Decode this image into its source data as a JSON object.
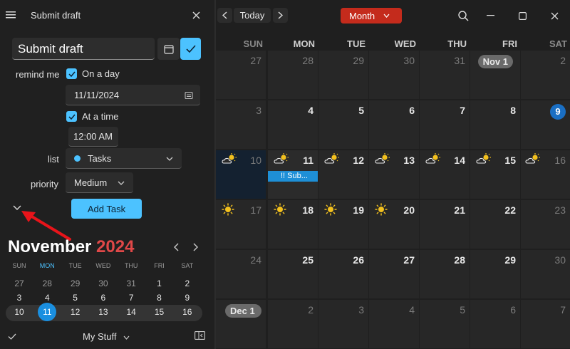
{
  "left": {
    "header_title": "Submit draft",
    "task_title": "Submit draft",
    "remind_label": "remind me",
    "on_a_day_label": "On a day",
    "date_value": "11/11/2024",
    "at_a_time_label": "At a time",
    "time_value": "12:00 AM",
    "list_label": "list",
    "list_value": "Tasks",
    "priority_label": "priority",
    "priority_value": "Medium",
    "add_task_label": "Add Task",
    "list_color": "#4cc2ff"
  },
  "mini_calendar": {
    "month": "November",
    "year": "2024",
    "weekdays": [
      "SUN",
      "MON",
      "TUE",
      "WED",
      "THU",
      "FRI",
      "SAT"
    ],
    "weeks": [
      [
        "27",
        "28",
        "29",
        "30",
        "31",
        "1",
        "2"
      ],
      [
        "3",
        "4",
        "5",
        "6",
        "7",
        "8",
        "9"
      ],
      [
        "10",
        "11",
        "12",
        "13",
        "14",
        "15",
        "16"
      ]
    ],
    "selected": "11",
    "footer_label": "My Stuff"
  },
  "toolbar": {
    "today_label": "Today",
    "view_label": "Month",
    "view_color": "#c42b1c"
  },
  "main_calendar": {
    "weekdays": [
      "SUN",
      "MON",
      "TUE",
      "WED",
      "THU",
      "FRI",
      "SAT"
    ],
    "weeks": [
      [
        "27",
        "28",
        "29",
        "30",
        "31",
        "Nov 1",
        "2"
      ],
      [
        "3",
        "4",
        "5",
        "6",
        "7",
        "8",
        "9"
      ],
      [
        "10",
        "11",
        "12",
        "13",
        "14",
        "15",
        "16"
      ],
      [
        "17",
        "18",
        "19",
        "20",
        "21",
        "22",
        "23"
      ],
      [
        "24",
        "25",
        "26",
        "27",
        "28",
        "29",
        "30"
      ],
      [
        "Dec 1",
        "2",
        "3",
        "4",
        "5",
        "6",
        "7"
      ]
    ],
    "event_label": "!! Sub...",
    "event_color": "#1e8fd6",
    "today_color": "#1a6fc4"
  }
}
